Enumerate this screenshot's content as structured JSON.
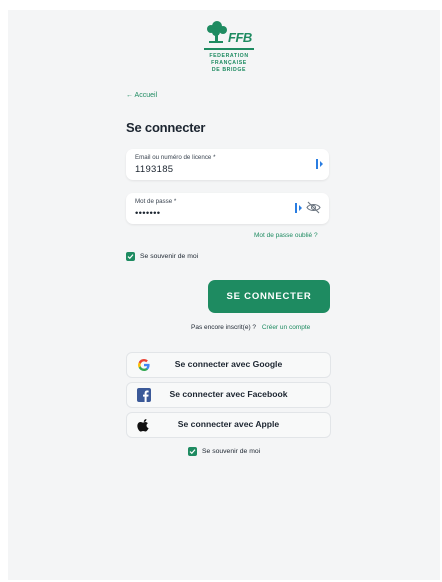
{
  "logo": {
    "word": "FFB",
    "lines": [
      "FEDERATION",
      "FRANÇAISE",
      "DE BRIDGE"
    ]
  },
  "nav": {
    "back_label": "← Accueil"
  },
  "heading": "Se connecter",
  "email_field": {
    "label": "Email ou numéro de licence *",
    "value": "1193185"
  },
  "password_field": {
    "label": "Mot de passe *",
    "value": "•••••••"
  },
  "forgot_password": "Mot de passe oublié ?",
  "remember_me": {
    "label": "Se souvenir de moi",
    "checked": true
  },
  "submit_label": "SE CONNECTER",
  "signup": {
    "prompt": "Pas encore inscrit(e) ?",
    "link": "Créer un compte"
  },
  "social": {
    "google": "Se connecter avec Google",
    "facebook": "Se connecter avec Facebook",
    "apple": "Se connecter avec Apple"
  },
  "remember_me_bottom": {
    "label": "Se souvenir de moi",
    "checked": true
  },
  "colors": {
    "brand_green": "#1e8b61",
    "background": "#f4f5f6",
    "facebook_blue": "#3b5998"
  }
}
